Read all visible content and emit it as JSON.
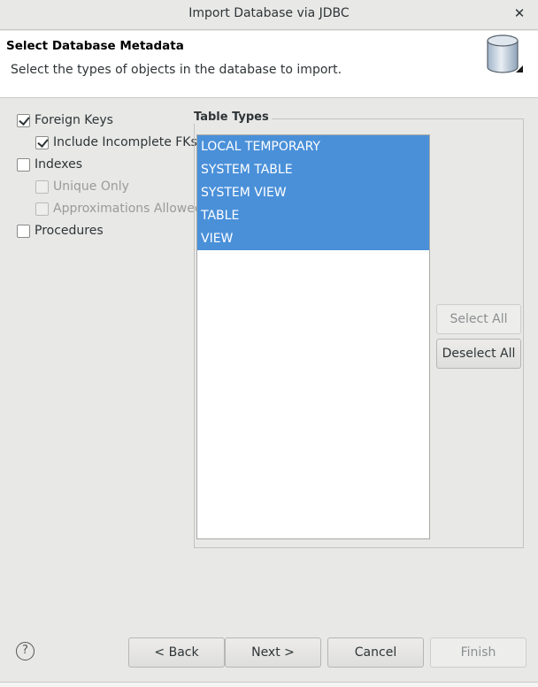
{
  "window": {
    "title": "Import Database via JDBC",
    "close_glyph": "✕"
  },
  "header": {
    "title": "Select Database Metadata",
    "description": "Select the types of objects in the database to import.",
    "icon": "database-icon"
  },
  "options": {
    "foreign_keys": {
      "label": "Foreign Keys",
      "checked": true,
      "enabled": true
    },
    "include_incomplete_fks": {
      "label": "Include Incomplete FKs",
      "checked": true,
      "enabled": true
    },
    "indexes": {
      "label": "Indexes",
      "checked": false,
      "enabled": true
    },
    "unique_only": {
      "label": "Unique Only",
      "checked": false,
      "enabled": false
    },
    "approximations_allowed": {
      "label": "Approximations Allowed",
      "checked": false,
      "enabled": false
    },
    "procedures": {
      "label": "Procedures",
      "checked": false,
      "enabled": true
    }
  },
  "table_types": {
    "legend": "Table Types",
    "items": [
      "LOCAL TEMPORARY",
      "SYSTEM TABLE",
      "SYSTEM VIEW",
      "TABLE",
      "VIEW"
    ],
    "select_all_label": "Select All",
    "deselect_all_label": "Deselect All"
  },
  "footer": {
    "help_glyph": "?",
    "back_label": "< Back",
    "next_label": "Next >",
    "cancel_label": "Cancel",
    "finish_label": "Finish"
  },
  "colors": {
    "selection": "#4a90d9",
    "window_bg": "#e8e8e7"
  }
}
